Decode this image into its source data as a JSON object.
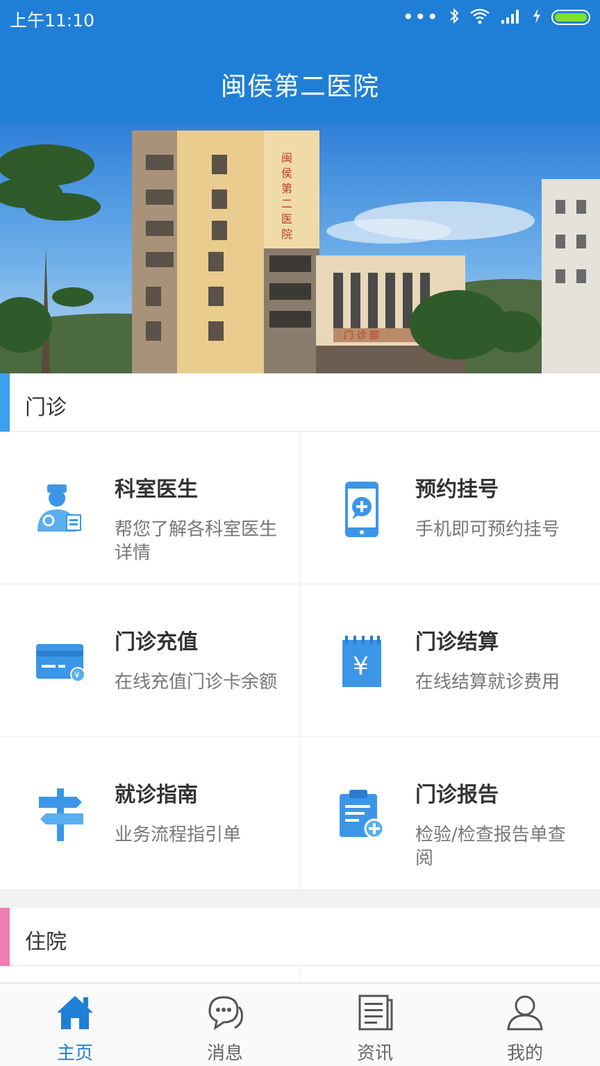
{
  "status_bar": {
    "time": "上午11:10",
    "battery_color": "#7ee12a"
  },
  "header": {
    "title": "闽侯第二医院",
    "color": "#1f7fd6"
  },
  "banner": {
    "sign_text": "闽侯第二医院",
    "door_sign": "门诊部"
  },
  "sections": {
    "outpatient": {
      "label": "门诊",
      "accent": "#3aa0f0"
    },
    "inpatient": {
      "label": "住院",
      "accent": "#f07fb0"
    }
  },
  "grid": [
    {
      "name": "科室医生",
      "desc": "帮您了解各科室医生详情",
      "icon": "doctor-icon"
    },
    {
      "name": "预约挂号",
      "desc": "手机即可预约挂号",
      "icon": "phone-appointment-icon"
    },
    {
      "name": "门诊充值",
      "desc": "在线充值门诊卡余额",
      "icon": "card-recharge-icon"
    },
    {
      "name": "门诊结算",
      "desc": "在线结算就诊费用",
      "icon": "bill-settlement-icon"
    },
    {
      "name": "就诊指南",
      "desc": "业务流程指引单",
      "icon": "signpost-icon"
    },
    {
      "name": "门诊报告",
      "desc": "检验/检查报告单查阅",
      "icon": "report-clipboard-icon"
    }
  ],
  "nav": [
    {
      "label": "主页",
      "icon": "home-icon",
      "active": true
    },
    {
      "label": "消息",
      "icon": "chat-icon",
      "active": false
    },
    {
      "label": "资讯",
      "icon": "news-icon",
      "active": false
    },
    {
      "label": "我的",
      "icon": "user-icon",
      "active": false
    }
  ]
}
